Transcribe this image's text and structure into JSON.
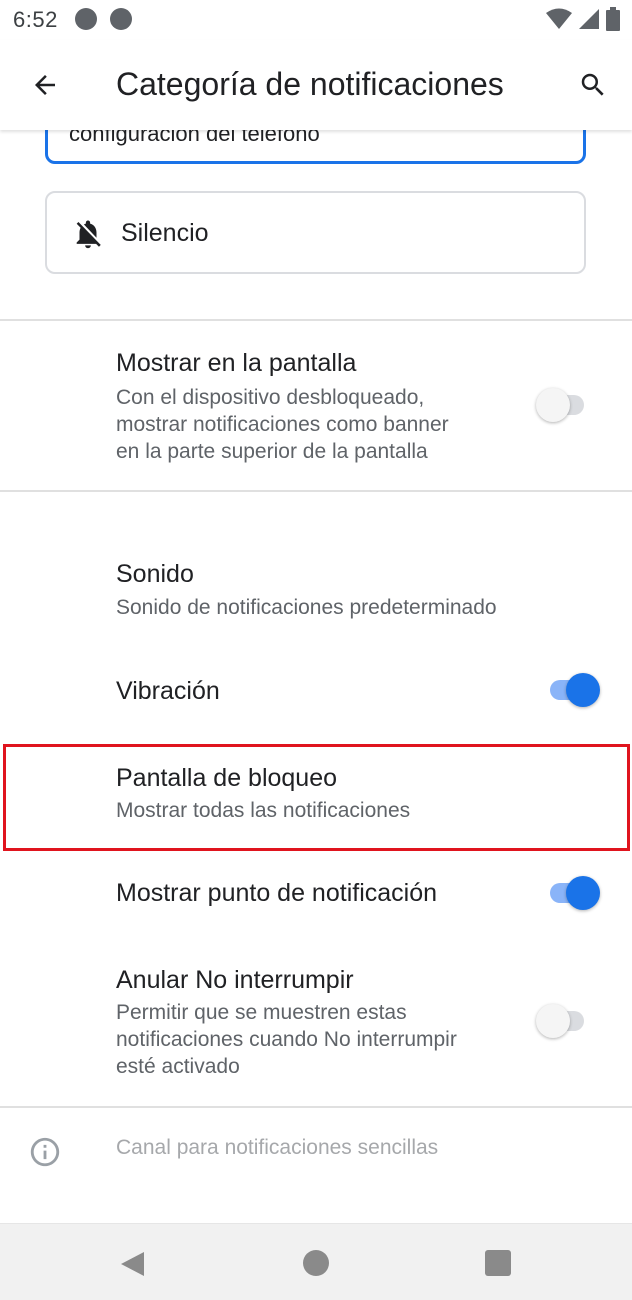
{
  "status_bar": {
    "time": "6:52",
    "left_icons": [
      "notification-app-icon",
      "notification-app-icon-2"
    ],
    "right_icons": [
      "wifi-icon",
      "signal-icon",
      "battery-icon"
    ]
  },
  "app_bar": {
    "title": "Categoría de notificaciones",
    "back_icon": "arrow-left-icon",
    "search_icon": "search-icon"
  },
  "behavior_options": {
    "default_text": "configuración del teléfono",
    "silent_label": "Silencio"
  },
  "settings": {
    "show_on_screen": {
      "title": "Mostrar en la pantalla",
      "subtitle_lines": [
        "Con el dispositivo desbloqueado,",
        "mostrar notificaciones como banner",
        "en la parte superior de la pantalla"
      ],
      "enabled": false
    },
    "sound": {
      "title": "Sonido",
      "subtitle": "Sonido de notificaciones predeterminado"
    },
    "vibration": {
      "title": "Vibración",
      "enabled": true
    },
    "lock_screen": {
      "title": "Pantalla de bloqueo",
      "subtitle": "Mostrar todas las notificaciones"
    },
    "notification_dot": {
      "title": "Mostrar punto de notificación",
      "enabled": true
    },
    "override_dnd": {
      "title": "Anular No interrumpir",
      "subtitle_lines": [
        "Permitir que se muestren estas",
        "notificaciones cuando No interrumpir",
        "esté activado"
      ],
      "enabled": false
    }
  },
  "footer": {
    "info_text": "Canal para notificaciones sencillas"
  },
  "colors": {
    "accent": "#1a73e8",
    "highlight": "#e0141e"
  }
}
